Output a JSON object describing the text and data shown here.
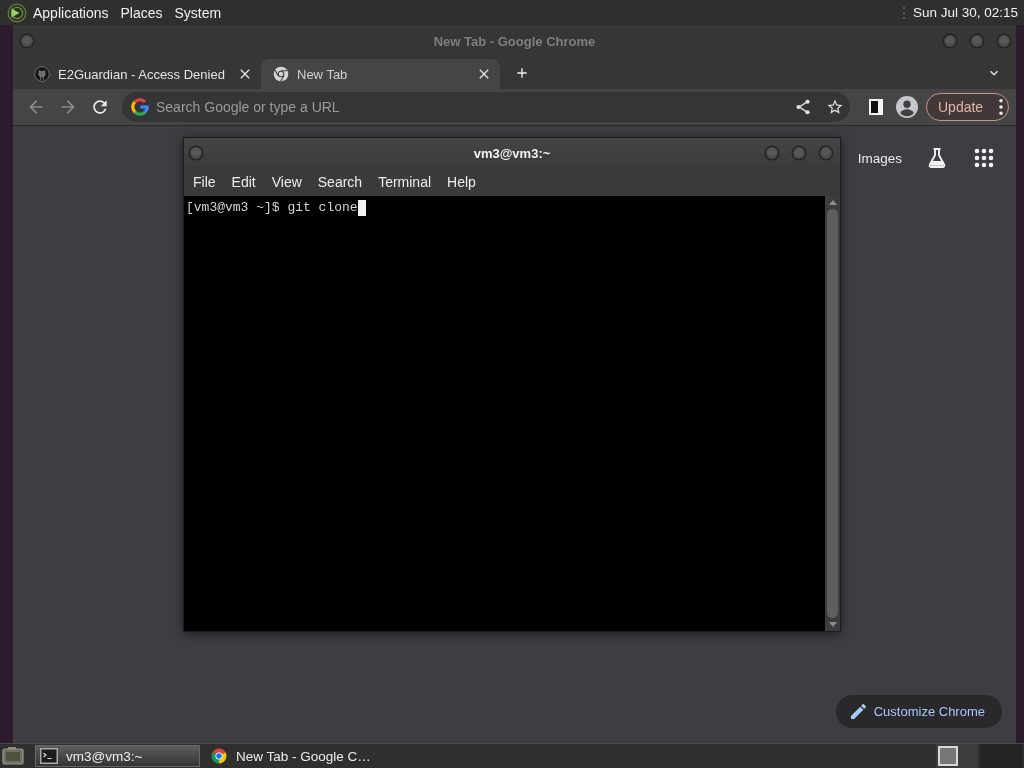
{
  "top_panel": {
    "menus": [
      "Applications",
      "Places",
      "System"
    ],
    "clock": "Sun Jul 30, 02:15"
  },
  "browser": {
    "title": "New Tab - Google Chrome",
    "tabs": [
      {
        "kind": "site",
        "label": "E2Guardian - Access Denied",
        "selected": false
      },
      {
        "kind": "newtab",
        "label": "New Tab",
        "selected": true
      }
    ],
    "omnibox": {
      "placeholder": "Search Google or type a URL"
    },
    "update_button": "Update",
    "header_links": [
      "Images"
    ],
    "customize_button": "Customize Chrome"
  },
  "terminal": {
    "title": "vm3@vm3:~",
    "menus": [
      "File",
      "Edit",
      "View",
      "Search",
      "Terminal",
      "Help"
    ],
    "lines": [
      "[vm3@vm3 ~]$ git clone"
    ]
  },
  "taskbar": {
    "tasks": [
      {
        "kind": "terminal",
        "label": "vm3@vm3:~",
        "selected": true
      },
      {
        "kind": "browser",
        "label": "New Tab - Google C…",
        "selected": false
      }
    ],
    "workspaces": [
      {
        "selected": true
      },
      {
        "selected": false
      }
    ]
  }
}
